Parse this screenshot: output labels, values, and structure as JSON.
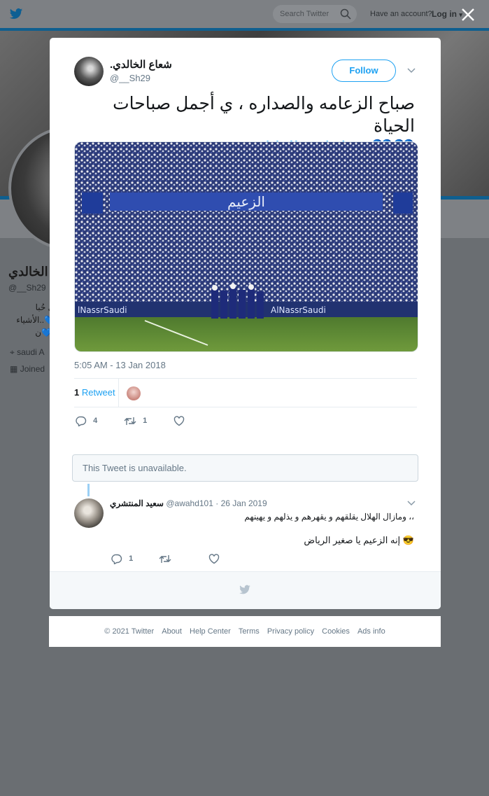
{
  "topbar": {
    "search_placeholder": "Search Twitter",
    "have_account": "Have an account?",
    "login_label": "Log in"
  },
  "background_profile": {
    "name": "الخالدي",
    "handle": "@__Sh29",
    "bio_lines": [
      "ي حُبا",
      "الأشياء..💙",
      "ن💙)"
    ],
    "location": "saudi A",
    "joined": "Joined"
  },
  "tweet": {
    "author_name": ".شعاع الخالدي",
    "author_handle": "@__Sh29",
    "follow_label": "Follow",
    "text_line1": "صباح الزعامه والصداره ، ي أجمل صباحات الحياة",
    "hashtag": "#صباحات_الهلال",
    "hearts": "💙💙",
    "media_banner_text": "الزعيم",
    "media_ad_left": "lNassrSaudi",
    "media_ad_right": "AlNassrSaudi",
    "timestamp": "5:05 AM - 13 Jan 2018",
    "retweet_count": "1",
    "retweet_label": "Retweet",
    "reply_count": "4",
    "retweet_action_count": "1"
  },
  "unavailable": {
    "text": "This Tweet is unavailable."
  },
  "reply": {
    "author_name": "سعيد المنتشري",
    "author_handle": "@awahd101",
    "date": "· 26 Jan 2019",
    "line1": "ومازال الهلال يقلقهم و يقهرهم و يذلهم و يهينهم ،،",
    "line2": "إنه الزعيم يا صغير الرياض",
    "emoji": "😎",
    "reply_count": "1"
  },
  "footer": {
    "copyright": "© 2021 Twitter",
    "about": "About",
    "help": "Help Center",
    "terms": "Terms",
    "privacy": "Privacy policy",
    "cookies": "Cookies",
    "ads": "Ads info"
  },
  "colors": {
    "accent": "#1da1f2",
    "overlay": "#6a6e72",
    "heart_blue": "#3fa3e2"
  }
}
